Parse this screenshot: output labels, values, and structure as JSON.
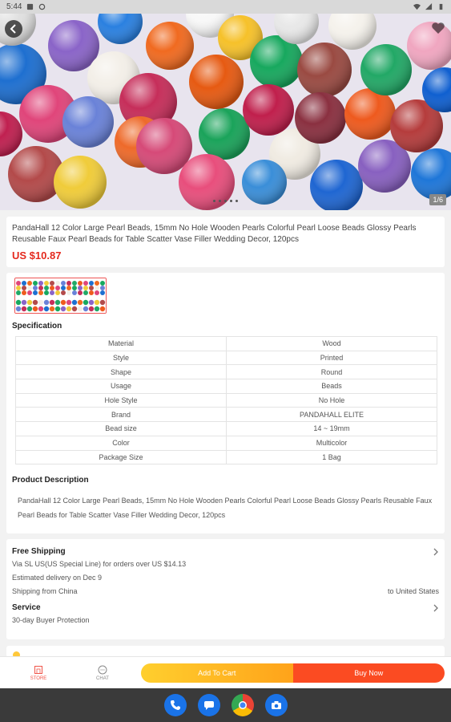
{
  "status_bar": {
    "time": "5:44"
  },
  "gallery": {
    "page_indicator": "1/6",
    "dot_count": 5
  },
  "product": {
    "title": "PandaHall 12 Color Large Pearl Beads, 15mm No Hole Wooden Pearls Colorful Pearl Loose Beads Glossy Pearls Reusable Faux Pearl Beads for Table Scatter Vase Filler Wedding Decor, 120pcs",
    "price": "US $10.87"
  },
  "specification": {
    "heading": "Specification",
    "rows": [
      {
        "name": "Material",
        "value": "Wood"
      },
      {
        "name": "Style",
        "value": "Printed"
      },
      {
        "name": "Shape",
        "value": "Round"
      },
      {
        "name": "Usage",
        "value": "Beads"
      },
      {
        "name": "Hole Style",
        "value": "No Hole"
      },
      {
        "name": "Brand",
        "value": "PANDAHALL ELITE"
      },
      {
        "name": "Bead size",
        "value": "14 ~ 19mm"
      },
      {
        "name": "Color",
        "value": "Multicolor"
      },
      {
        "name": "Package Size",
        "value": "1 Bag"
      }
    ]
  },
  "description": {
    "heading": "Product Description",
    "text": "PandaHall 12 Color Large Pearl Beads, 15mm No Hole Wooden Pearls Colorful Pearl Loose Beads Glossy Pearls Reusable Faux Pearl Beads for Table Scatter Vase Filler Wedding Decor, 120pcs"
  },
  "shipping": {
    "heading": "Free Shipping",
    "method": "Via SL US(US Special Line)  for orders over US $14.13",
    "delivery": "Estimated delivery on Dec 9",
    "from": "Shipping from China",
    "to": "to United States"
  },
  "service": {
    "heading": "Service",
    "text": "30-day Buyer Protection"
  },
  "bottom_bar": {
    "store_label": "STORE",
    "chat_label": "CHAT",
    "add_to_cart": "Add To Cart",
    "buy_now": "Buy Now"
  },
  "colors": {
    "price": "#e4291e",
    "buy_now": "#fb4b22",
    "add_to_cart": "#ffb320"
  }
}
